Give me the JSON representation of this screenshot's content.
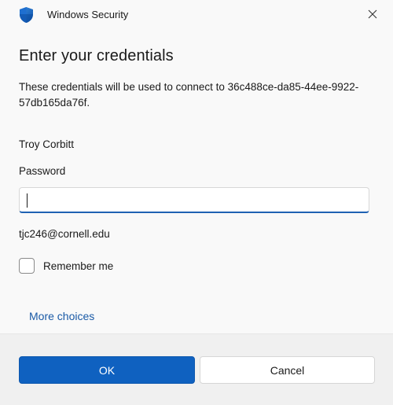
{
  "window": {
    "title": "Windows Security",
    "icon": "shield-icon",
    "accent_color": "#0f61c0"
  },
  "dialog": {
    "heading": "Enter your credentials",
    "description": "These credentials will be used to connect to 36c488ce-da85-44ee-9922-57db165da76f.",
    "username": "Troy Corbitt",
    "password_label": "Password",
    "password_value": "",
    "account_email": "tjc246@cornell.edu",
    "remember_me_label": "Remember me",
    "remember_me_checked": false,
    "more_choices_label": "More choices"
  },
  "buttons": {
    "ok_label": "OK",
    "cancel_label": "Cancel"
  }
}
